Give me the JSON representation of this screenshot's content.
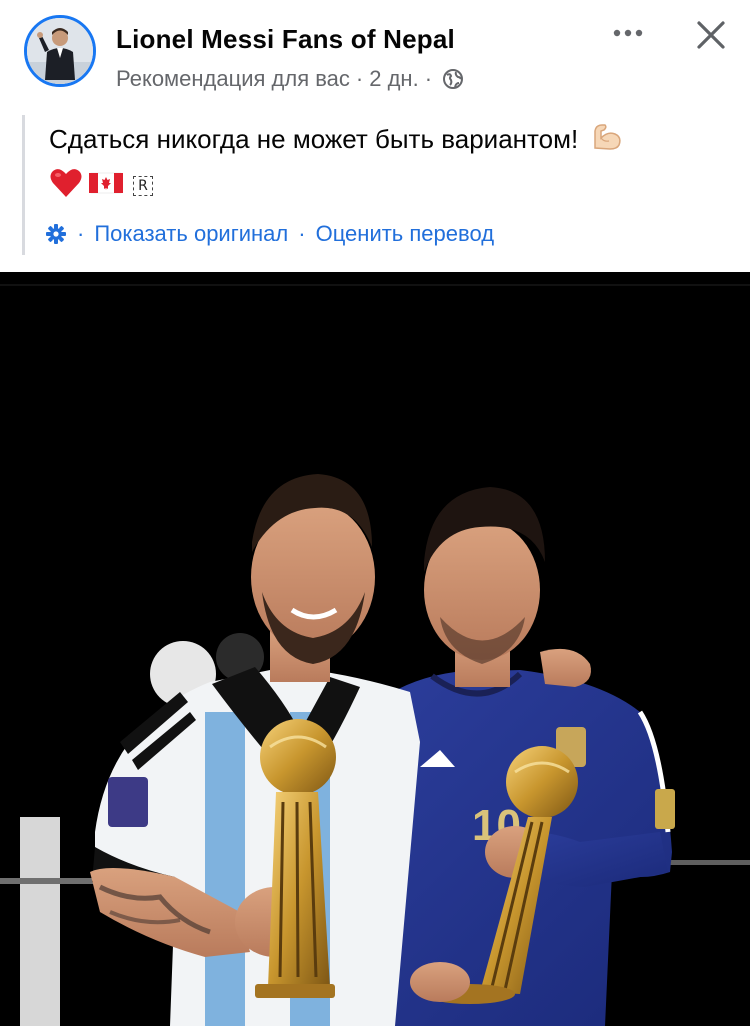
{
  "post": {
    "page_name": "Lionel Messi Fans of Nepal",
    "recommendation": "Рекомендация для вас",
    "time": "2 дн.",
    "separator": "·",
    "text": "Сдаться никогда не может быть вариантом!",
    "emoji_muscle": "muscle-emoji",
    "emoji_heart": "red-heart-emoji",
    "emoji_flag": "canada-flag-emoji",
    "badge_letter": "R",
    "show_original": "Показать оригинал",
    "rate_translation": "Оценить перевод",
    "translate_dot": "·"
  },
  "icons": {
    "globe": "globe-icon",
    "more": "more-options-icon",
    "close": "close-icon",
    "settings": "gear-icon"
  },
  "colors": {
    "link": "#216fdb",
    "meta": "#65676b",
    "avatar_ring": "#1877f2",
    "image_bg": "#000000"
  }
}
